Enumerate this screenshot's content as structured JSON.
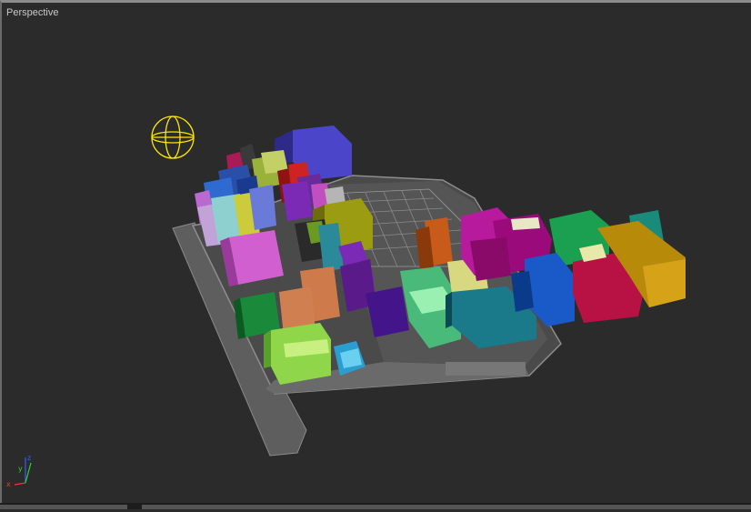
{
  "viewport": {
    "label": "Perspective"
  },
  "axis_gizmo": {
    "x_label": "x",
    "y_label": "y",
    "z_label": "z"
  },
  "colors": {
    "background": "#2b2b2b",
    "road": "#6b6b6b",
    "road_edge": "#9a9a9a",
    "light_gizmo": "#ffe600",
    "axis_x": "#ff3030",
    "axis_y": "#30d030",
    "axis_z": "#3060ff"
  }
}
